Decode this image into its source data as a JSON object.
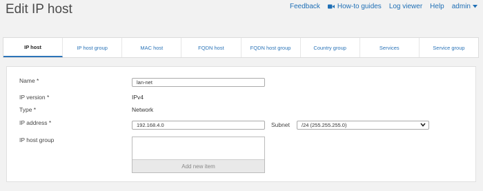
{
  "page": {
    "title": "Edit IP host"
  },
  "topnav": {
    "feedback": "Feedback",
    "howto": "How-to guides",
    "logviewer": "Log viewer",
    "help": "Help",
    "user": "admin"
  },
  "tabs": [
    {
      "label": "IP host",
      "active": true
    },
    {
      "label": "IP host group"
    },
    {
      "label": "MAC host"
    },
    {
      "label": "FQDN host"
    },
    {
      "label": "FQDN host group"
    },
    {
      "label": "Country group"
    },
    {
      "label": "Services"
    },
    {
      "label": "Service group"
    }
  ],
  "form": {
    "name_label": "Name *",
    "name_value": "lan-net",
    "ipversion_label": "IP version *",
    "ipversion_value": "IPv4",
    "type_label": "Type *",
    "type_value": "Network",
    "ipaddress_label": "IP address *",
    "ipaddress_value": "192.168.4.0",
    "subnet_label": "Subnet",
    "subnet_value": "/24 (255.255.255.0)",
    "hostgroup_label": "IP host group",
    "add_item": "Add new item"
  },
  "colors": {
    "link": "#1f6fb5",
    "accent": "#2b74b8"
  },
  "icons": {
    "howto": "video-camera-icon",
    "user_menu": "caret-down-icon",
    "subnet": "chevron-down-icon"
  }
}
